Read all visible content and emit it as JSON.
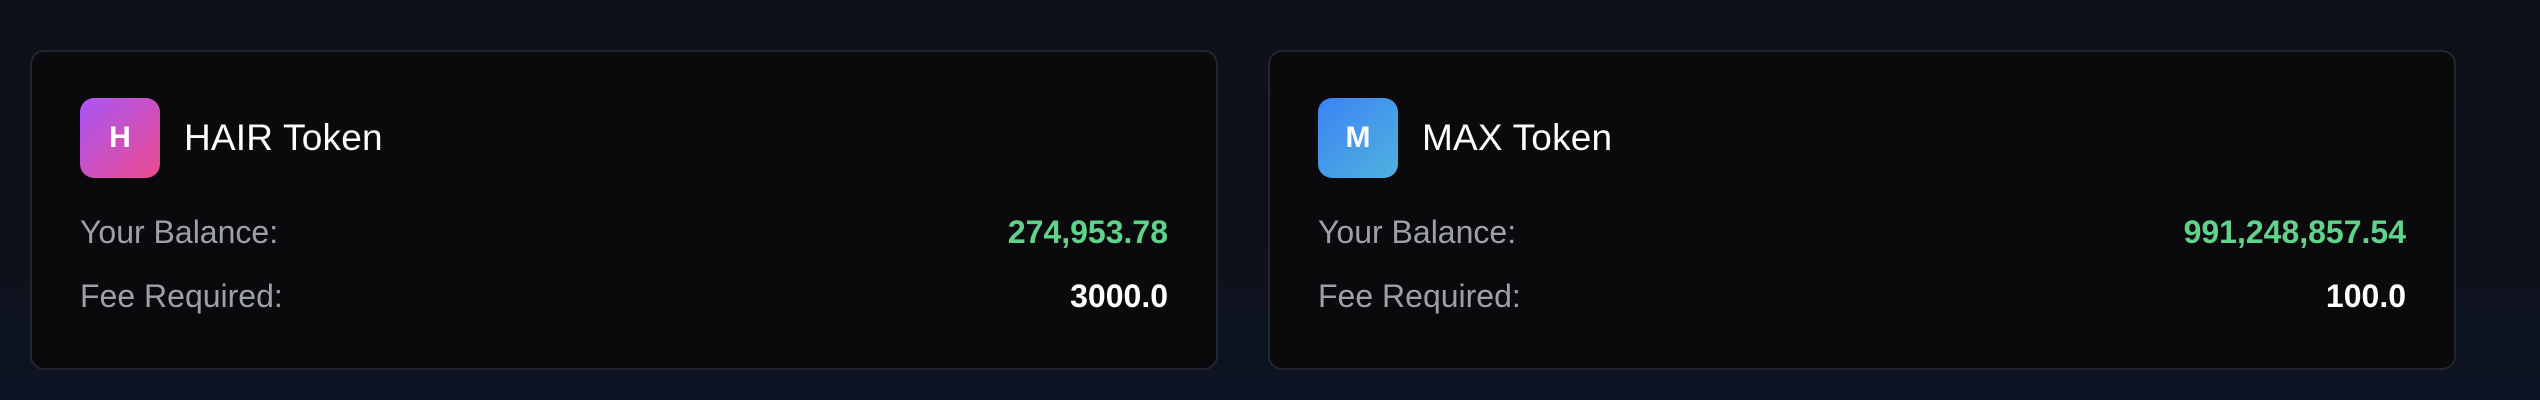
{
  "cards": [
    {
      "avatar_letter": "H",
      "name": "HAIR Token",
      "balance_label": "Your Balance:",
      "balance_value": "274,953.78",
      "fee_label": "Fee Required:",
      "fee_value": "3000.0",
      "avatar_gradient": [
        "#a955f7",
        "#ec4c8d"
      ]
    },
    {
      "avatar_letter": "M",
      "name": "MAX Token",
      "balance_label": "Your Balance:",
      "balance_value": "991,248,857.54",
      "fee_label": "Fee Required:",
      "fee_value": "100.0",
      "avatar_gradient": [
        "#3b82f6",
        "#4fb3dc"
      ]
    }
  ],
  "colors": {
    "background": "#0d111a",
    "card_background": "#0a0a0c",
    "card_border": "#23262d",
    "balance_positive": "#5fd38a",
    "label_text": "#9ca0a8",
    "primary_text": "#ffffff"
  }
}
